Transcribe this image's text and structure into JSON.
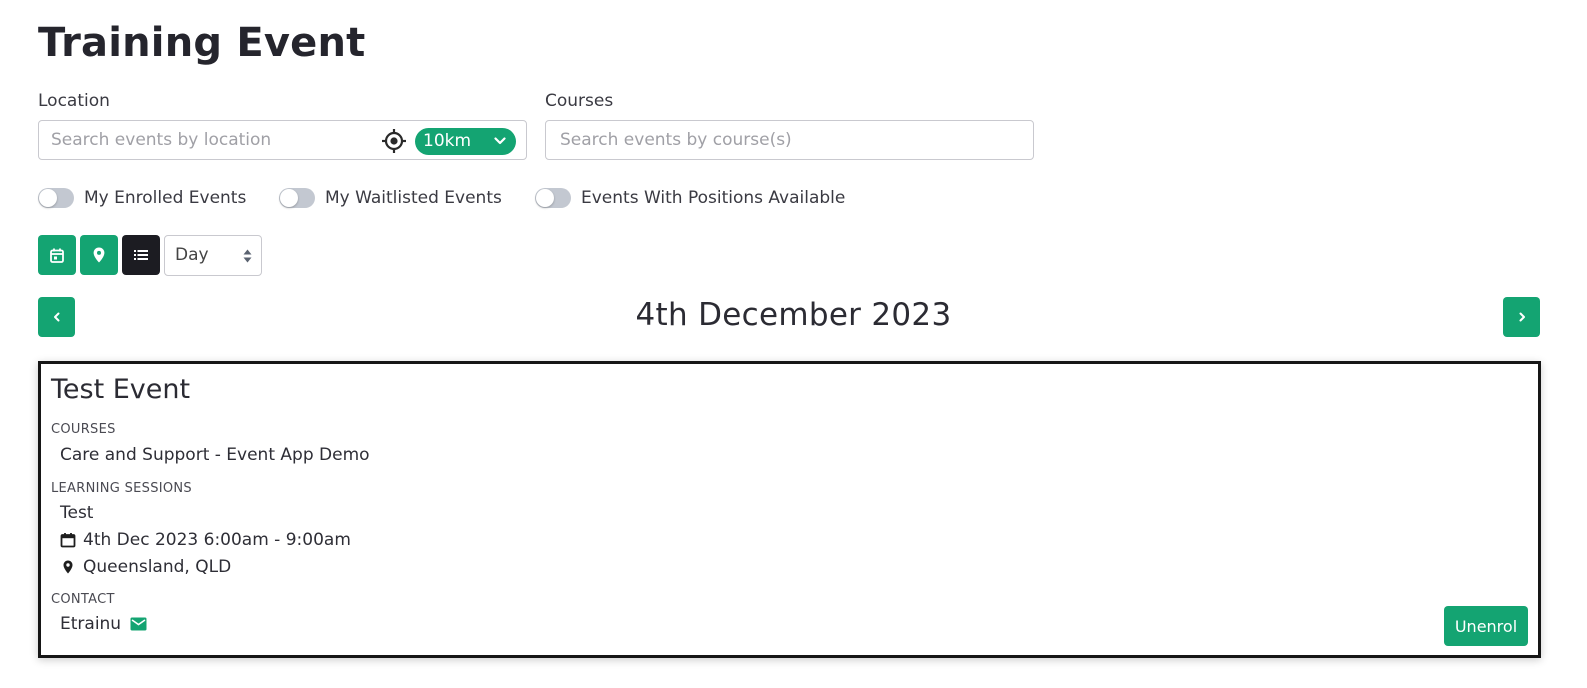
{
  "page": {
    "title": "Training Event"
  },
  "filters": {
    "location_label": "Location",
    "location_placeholder": "Search events by location",
    "radius_value": "10km",
    "courses_label": "Courses",
    "courses_placeholder": "Search events by course(s)"
  },
  "toggles": [
    {
      "label": "My Enrolled Events",
      "on": false
    },
    {
      "label": "My Waitlisted Events",
      "on": false
    },
    {
      "label": "Events With Positions Available",
      "on": false
    }
  ],
  "view": {
    "modes": [
      "calendar",
      "map",
      "list"
    ],
    "active_mode": "list",
    "period_selected": "Day"
  },
  "date_nav": {
    "current_date": "4th December 2023"
  },
  "event": {
    "title": "Test Event",
    "courses_heading": "COURSES",
    "course": "Care and Support - Event App Demo",
    "sessions_heading": "LEARNING SESSIONS",
    "session_name": "Test",
    "session_datetime": "4th Dec 2023 6:00am - 9:00am",
    "session_location": "Queensland, QLD",
    "contact_heading": "CONTACT",
    "contact_name": "Etrainu",
    "action_label": "Unenrol"
  },
  "colors": {
    "accent": "#14a472",
    "active_view": "#1c1c22",
    "text": "#2b2b33"
  },
  "icons": [
    "locate-target-icon",
    "chevron-down-icon",
    "calendar-icon",
    "map-pin-icon",
    "list-icon",
    "select-arrows-icon",
    "chevron-left-icon",
    "chevron-right-icon",
    "mail-icon"
  ]
}
